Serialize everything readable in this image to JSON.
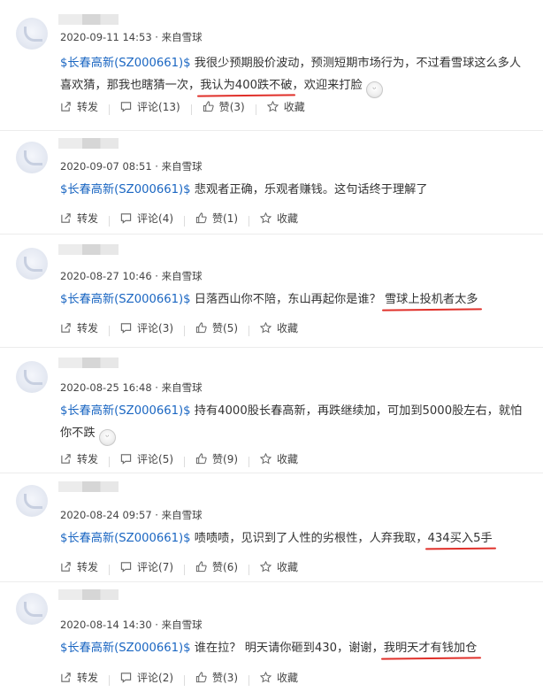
{
  "colors": {
    "link": "#1a66c2",
    "annotation": "#e0302a",
    "text": "#333333",
    "meta": "#444444"
  },
  "labels": {
    "repost": "转发",
    "comment": "评论",
    "like": "赞",
    "favorite": "收藏"
  },
  "posts": [
    {
      "time": "2020-09-11 14:53",
      "source": "· 来自雪球",
      "stock": "$长春高新(SZ000661)$",
      "text_before": " 我很少预期股价波动，预测短期市场行为，不过看雪球这么多人喜欢猜，那我也瞎猜一次，",
      "highlight": "我认为400跌不破",
      "text_after": "，欢迎来打脸",
      "emoji": "emoji-laugh",
      "comments": "(13)",
      "likes": "(3)"
    },
    {
      "time": "2020-09-07 08:51",
      "source": "· 来自雪球",
      "stock": "$长春高新(SZ000661)$",
      "text_before": " 悲观者正确，乐观者赚钱。这句话终于理解了",
      "highlight": "",
      "text_after": "",
      "emoji": "",
      "comments": "(4)",
      "likes": "(1)"
    },
    {
      "time": "2020-08-27 10:46",
      "source": "· 来自雪球",
      "stock": "$长春高新(SZ000661)$",
      "text_before": " 日落西山你不陪，东山再起你是谁？ ",
      "highlight": "雪球上投机者太多",
      "text_after": "",
      "emoji": "",
      "comments": "(3)",
      "likes": "(5)"
    },
    {
      "time": "2020-08-25 16:48",
      "source": "· 来自雪球",
      "stock": "$长春高新(SZ000661)$",
      "text_before": " 持有4000股长春高新，再跌继续加，可加到5000股左右，就怕你不跌",
      "highlight": "",
      "text_after": "",
      "emoji": "emoji-grin",
      "comments": "(5)",
      "likes": "(9)"
    },
    {
      "time": "2020-08-24 09:57",
      "source": "· 来自雪球",
      "stock": "$长春高新(SZ000661)$",
      "text_before": " 啧啧啧，见识到了人性的劣根性，人弃我取，",
      "highlight": "434买入5手",
      "text_after": "",
      "emoji": "",
      "comments": "(7)",
      "likes": "(6)"
    },
    {
      "time": "2020-08-14 14:30",
      "source": "· 来自雪球",
      "stock": "$长春高新(SZ000661)$",
      "text_before": " 谁在拉？ 明天请你砸到430，谢谢，",
      "highlight": "我明天才有钱加仓",
      "text_after": "",
      "emoji": "",
      "comments": "(2)",
      "likes": "(3)"
    }
  ]
}
